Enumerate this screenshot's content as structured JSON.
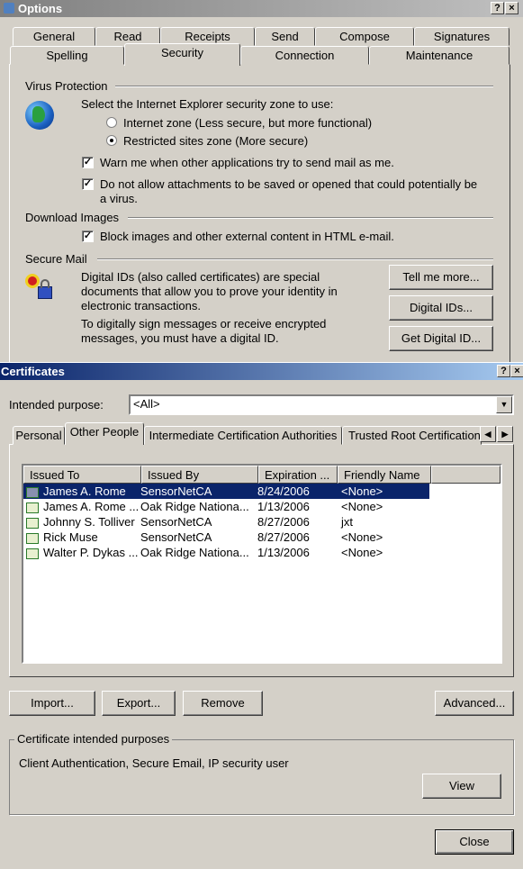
{
  "options": {
    "title": "Options",
    "tabs_row1": [
      "General",
      "Read",
      "Receipts",
      "Send",
      "Compose",
      "Signatures"
    ],
    "tabs_row2": [
      "Spelling",
      "Security",
      "Connection",
      "Maintenance"
    ],
    "active_tab": "Security",
    "virus": {
      "heading": "Virus Protection",
      "zone_prompt": "Select the Internet Explorer security zone to use:",
      "radio_internet": "Internet zone (Less secure, but more functional)",
      "radio_restricted": "Restricted sites zone (More secure)",
      "selected": "restricted",
      "warn_label": "Warn me when other applications try to send mail as me.",
      "warn_checked": true,
      "attach_line1": "Do not allow attachments to be saved or opened that could potentially be",
      "attach_line2": "a virus.",
      "attach_checked": true
    },
    "download": {
      "heading": "Download Images",
      "block_label": "Block images and other external content in HTML e-mail.",
      "block_checked": true
    },
    "secure": {
      "heading": "Secure Mail",
      "text1": [
        "Digital IDs (also called certificates) are special",
        "documents that allow you to prove your identity in",
        "electronic transactions."
      ],
      "text2": [
        "To digitally sign messages or receive encrypted",
        "messages, you must have a digital ID."
      ],
      "tell_me": "Tell me more...",
      "digital_ids": "Digital IDs...",
      "get_id": "Get Digital ID..."
    }
  },
  "certs": {
    "title": "Certificates",
    "purpose_label": "Intended purpose:",
    "purpose_value": "<All>",
    "tabs": [
      "Personal",
      "Other People",
      "Intermediate Certification Authorities",
      "Trusted Root Certification"
    ],
    "active_tab": "Other People",
    "columns": [
      "Issued To",
      "Issued By",
      "Expiration ...",
      "Friendly Name"
    ],
    "rows": [
      [
        "James A. Rome",
        "SensorNetCA",
        "8/24/2006",
        "<None>"
      ],
      [
        "James A. Rome ...",
        "Oak Ridge Nationa...",
        "1/13/2006",
        "<None>"
      ],
      [
        "Johnny S. Tolliver",
        "SensorNetCA",
        "8/27/2006",
        "jxt"
      ],
      [
        "Rick Muse",
        "SensorNetCA",
        "8/27/2006",
        "<None>"
      ],
      [
        "Walter P. Dykas ...",
        "Oak Ridge Nationa...",
        "1/13/2006",
        "<None>"
      ]
    ],
    "selected_row": 0,
    "import": "Import...",
    "export": "Export...",
    "remove": "Remove",
    "advanced": "Advanced...",
    "purposes_heading": "Certificate intended purposes",
    "purposes_value": "Client Authentication, Secure Email, IP security user",
    "view": "View",
    "close": "Close"
  }
}
